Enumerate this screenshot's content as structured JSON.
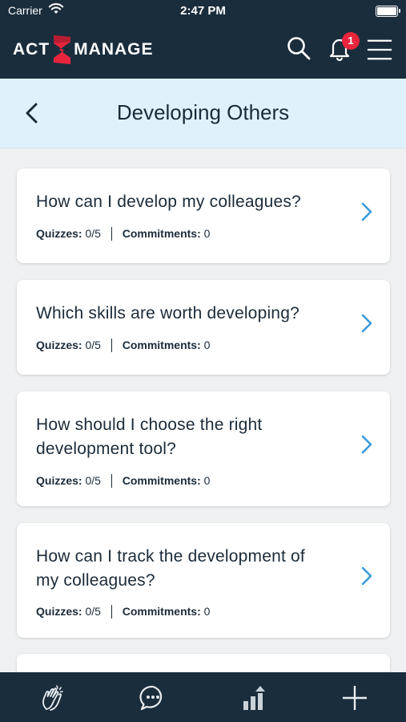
{
  "status_bar": {
    "carrier": "Carrier",
    "time": "2:47 PM"
  },
  "header": {
    "logo_left": "ACT",
    "logo_right": "MANAGE",
    "notification_count": "1"
  },
  "subheader": {
    "title": "Developing Others"
  },
  "topics": [
    {
      "title_lines": [
        "How can I develop my colleagues?"
      ],
      "quizzes_label": "Quizzes:",
      "quizzes_value": "0/5",
      "commitments_label": "Commitments:",
      "commitments_value": "0"
    },
    {
      "title_lines": [
        "Which skills are worth developing?"
      ],
      "quizzes_label": "Quizzes:",
      "quizzes_value": "0/5",
      "commitments_label": "Commitments:",
      "commitments_value": "0"
    },
    {
      "title_lines": [
        "How should I choose the right",
        "development tool?"
      ],
      "quizzes_label": "Quizzes:",
      "quizzes_value": "0/5",
      "commitments_label": "Commitments:",
      "commitments_value": "0"
    },
    {
      "title_lines": [
        "How can I track the development of",
        "my colleagues?"
      ],
      "quizzes_label": "Quizzes:",
      "quizzes_value": "0/5",
      "commitments_label": "Commitments:",
      "commitments_value": "0"
    }
  ],
  "colors": {
    "header_bg": "#1a2d3d",
    "subheader_bg": "#dff2fb",
    "accent_blue": "#3a9ad9",
    "badge_red": "#e8253c",
    "logo_red": "#e8253c"
  },
  "icons": {
    "header": [
      "search-icon",
      "bell-icon",
      "menu-icon"
    ],
    "bottom_nav": [
      "clapping-hands-icon",
      "chat-icon",
      "bar-chart-icon",
      "plus-icon"
    ]
  }
}
